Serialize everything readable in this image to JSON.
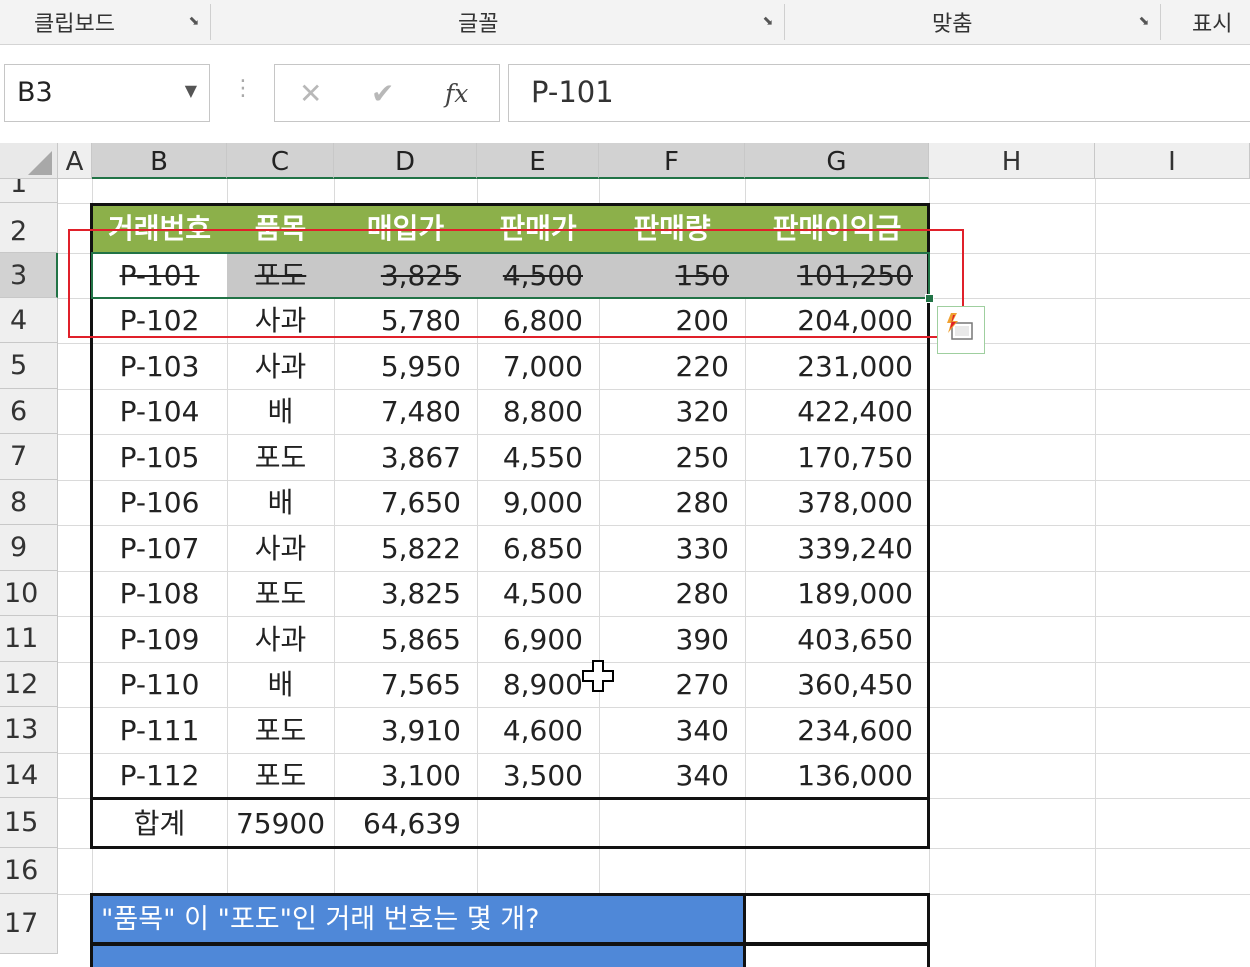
{
  "ribbon": {
    "groups": [
      "클립보드",
      "글꼴",
      "맞춤",
      "표시"
    ],
    "launcher_glyph": "⬊"
  },
  "formula_bar": {
    "name_box": "B3",
    "cancel_glyph": "✕",
    "enter_glyph": "✔",
    "fx_glyph": "fx",
    "formula": "P-101"
  },
  "columns": [
    "A",
    "B",
    "C",
    "D",
    "E",
    "F",
    "G",
    "H",
    "I"
  ],
  "rows": [
    "1",
    "2",
    "3",
    "4",
    "5",
    "6",
    "7",
    "8",
    "9",
    "10",
    "11",
    "12",
    "13",
    "14",
    "15",
    "16",
    "17"
  ],
  "table": {
    "headers": [
      "거래번호",
      "품목",
      "매입가",
      "판매가",
      "판매량",
      "판매이익금"
    ],
    "rows": [
      [
        "P-101",
        "포도",
        "3,825",
        "4,500",
        "150",
        "101,250"
      ],
      [
        "P-102",
        "사과",
        "5,780",
        "6,800",
        "200",
        "204,000"
      ],
      [
        "P-103",
        "사과",
        "5,950",
        "7,000",
        "220",
        "231,000"
      ],
      [
        "P-104",
        "배",
        "7,480",
        "8,800",
        "320",
        "422,400"
      ],
      [
        "P-105",
        "포도",
        "3,867",
        "4,550",
        "250",
        "170,750"
      ],
      [
        "P-106",
        "배",
        "7,650",
        "9,000",
        "280",
        "378,000"
      ],
      [
        "P-107",
        "사과",
        "5,822",
        "6,850",
        "330",
        "339,240"
      ],
      [
        "P-108",
        "포도",
        "3,825",
        "4,500",
        "280",
        "189,000"
      ],
      [
        "P-109",
        "사과",
        "5,865",
        "6,900",
        "390",
        "403,650"
      ],
      [
        "P-110",
        "배",
        "7,565",
        "8,900",
        "270",
        "360,450"
      ],
      [
        "P-111",
        "포도",
        "3,910",
        "4,600",
        "340",
        "234,600"
      ],
      [
        "P-112",
        "포도",
        "3,100",
        "3,500",
        "340",
        "136,000"
      ]
    ],
    "total": [
      "합계",
      "75900",
      "64,639"
    ],
    "question": "\"품목\" 이 \"포도\"인 거래 번호는 몇 개?"
  },
  "colors": {
    "header_green": "#8cb04a",
    "question_blue": "#4f88d8",
    "selection_green": "#217346",
    "annotation_red": "#e0202a"
  }
}
